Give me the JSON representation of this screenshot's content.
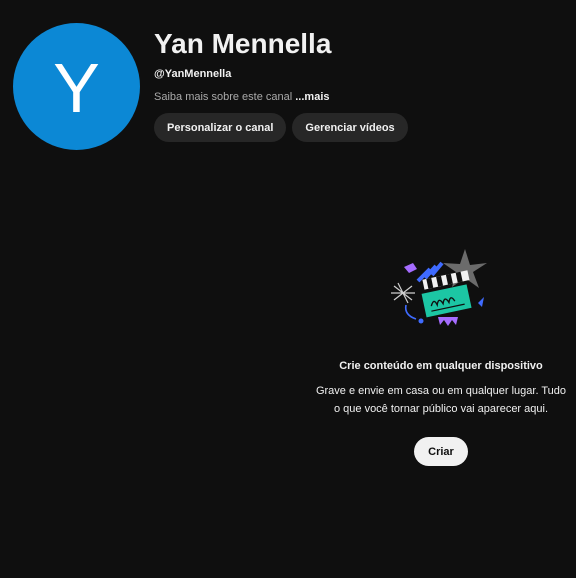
{
  "channel": {
    "avatar_letter": "Y",
    "avatar_color": "#0c88d5",
    "name": "Yan Mennella",
    "handle": "@YanMennella",
    "about_text": "Saiba mais sobre este canal",
    "about_more": "...mais"
  },
  "actions": {
    "customize_label": "Personalizar o canal",
    "manage_label": "Gerenciar vídeos"
  },
  "empty_state": {
    "illustration": "clapperboard-illustration",
    "title": "Crie conteúdo em qualquer dispositivo",
    "description": "Grave e envie em casa ou em qualquer lugar. Tudo o que você tornar público vai aparecer aqui.",
    "create_label": "Criar"
  },
  "colors": {
    "background": "#0f0f0f",
    "pill_background": "#272727",
    "create_button": "#f1f1f1"
  }
}
